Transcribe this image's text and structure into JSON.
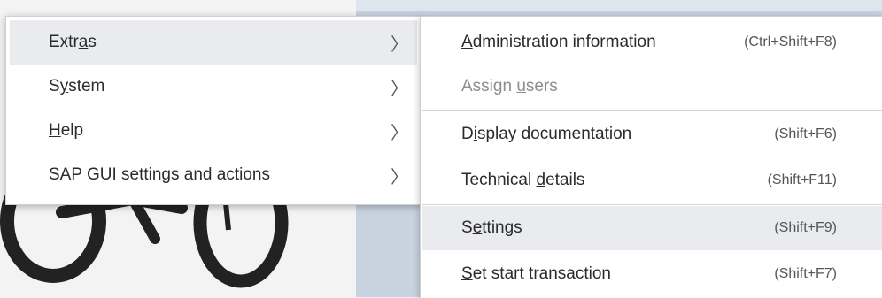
{
  "main_menu": {
    "items": [
      {
        "pre": "Extr",
        "ul": "a",
        "post": "s",
        "active": true
      },
      {
        "pre": "S",
        "ul": "y",
        "post": "stem",
        "active": false
      },
      {
        "pre": "",
        "ul": "H",
        "post": "elp",
        "active": false
      },
      {
        "pre": "SAP GUI settings and actions",
        "ul": "",
        "post": "",
        "active": false
      }
    ],
    "chevron": "〉"
  },
  "sub_menu": {
    "items": [
      {
        "pre": "",
        "ul": "A",
        "post": "dministration information",
        "shortcut": "(Ctrl+Shift+F8)",
        "disabled": false,
        "active": false
      },
      {
        "pre": "Assign ",
        "ul": "u",
        "post": "sers",
        "shortcut": "",
        "disabled": true,
        "active": false
      },
      {
        "pre": "D",
        "ul": "i",
        "post": "splay documentation",
        "shortcut": "(Shift+F6)",
        "disabled": false,
        "active": false
      },
      {
        "pre": "Technical ",
        "ul": "d",
        "post": "etails",
        "shortcut": "(Shift+F11)",
        "disabled": false,
        "active": false
      },
      {
        "pre": "S",
        "ul": "e",
        "post": "ttings",
        "shortcut": "(Shift+F9)",
        "disabled": false,
        "active": true
      },
      {
        "pre": "",
        "ul": "S",
        "post": "et start transaction",
        "shortcut": "(Shift+F7)",
        "disabled": false,
        "active": false
      }
    ]
  },
  "colors": {
    "hover": "#e9ebee",
    "text": "#2b2b2b",
    "disabled": "#8e8e8e"
  }
}
